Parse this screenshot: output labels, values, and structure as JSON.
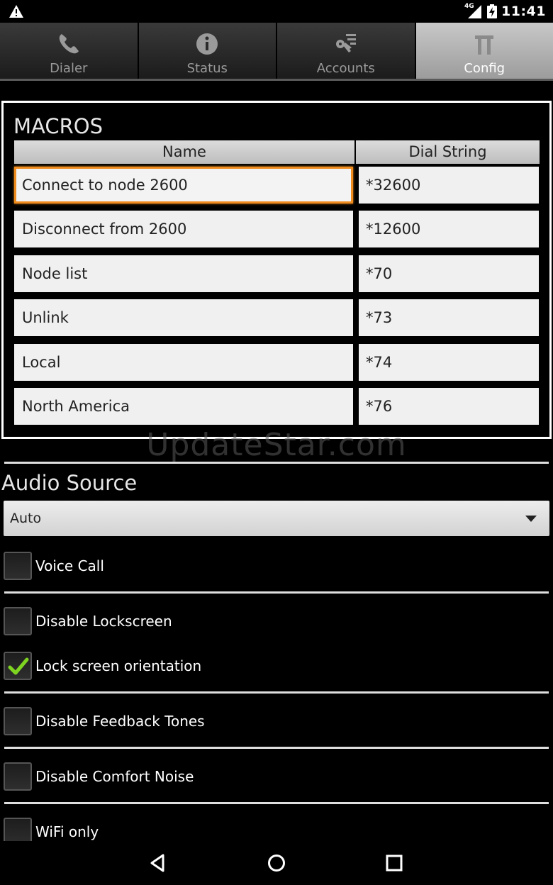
{
  "status_bar": {
    "time": "11:41",
    "network_label": "4G",
    "icons": [
      "warning-icon",
      "signal-icon",
      "battery-charging-icon"
    ]
  },
  "tabs": [
    {
      "label": "Dialer",
      "icon": "phone-icon",
      "active": false
    },
    {
      "label": "Status",
      "icon": "info-icon",
      "active": false
    },
    {
      "label": "Accounts",
      "icon": "key-list-icon",
      "active": false
    },
    {
      "label": "Config",
      "icon": "tools-icon",
      "active": true
    }
  ],
  "macros": {
    "title": "MACROS",
    "columns": [
      "Name",
      "Dial String"
    ],
    "rows": [
      {
        "name": "Connect to node 2600",
        "dial": "*32600"
      },
      {
        "name": "Disconnect from 2600",
        "dial": "*12600"
      },
      {
        "name": "Node list",
        "dial": "*70"
      },
      {
        "name": "Unlink",
        "dial": "*73"
      },
      {
        "name": "Local",
        "dial": "*74"
      },
      {
        "name": "North America",
        "dial": "*76"
      }
    ]
  },
  "watermark": "UpdateStar.com",
  "audio_source": {
    "title": "Audio Source",
    "selected": "Auto"
  },
  "options": [
    {
      "label": "Voice Call",
      "checked": false
    },
    {
      "label": "Disable Lockscreen",
      "checked": false
    },
    {
      "label": "Lock screen orientation",
      "checked": true
    },
    {
      "label": "Disable Feedback Tones",
      "checked": false
    },
    {
      "label": "Disable Comfort Noise",
      "checked": false
    },
    {
      "label": "WiFi only",
      "checked": false
    }
  ],
  "colors": {
    "focus_border": "#f08c1e",
    "check_mark": "#7ed321",
    "active_tab": "#b4b4b4"
  },
  "nav_bar": [
    "back-icon",
    "home-icon",
    "recents-icon"
  ]
}
